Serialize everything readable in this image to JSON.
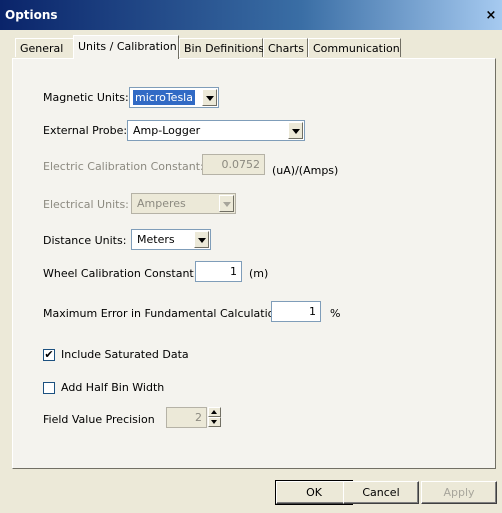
{
  "window": {
    "title": "Options",
    "close_glyph": "×"
  },
  "tabs": [
    "General",
    "Units / Calibration",
    "Bin Definitions",
    "Charts",
    "Communication"
  ],
  "active_tab": "Units / Calibration",
  "form": {
    "magnetic_units": {
      "label": "Magnetic Units:",
      "value": "microTesla"
    },
    "external_probe": {
      "label": "External Probe:",
      "value": "Amp-Logger"
    },
    "electric_calibration": {
      "label": "Electric Calibration Constant:",
      "value": "0.0752",
      "unit": "(uA)/(Amps)"
    },
    "electrical_units": {
      "label": "Electrical Units:",
      "value": "Amperes"
    },
    "distance_units": {
      "label": "Distance Units:",
      "value": "Meters"
    },
    "wheel_calibration": {
      "label": "Wheel Calibration Constant:",
      "value": "1",
      "unit": "(m)"
    },
    "max_error": {
      "label": "Maximum Error in Fundamental Calculation:",
      "value": "1",
      "unit": "%"
    },
    "include_saturated": {
      "label": "Include Saturated Data",
      "checked": true,
      "mark": "✔"
    },
    "add_half_bin": {
      "label": "Add Half Bin Width",
      "checked": false,
      "mark": ""
    },
    "field_precision": {
      "label": "Field Value Precision",
      "value": "2"
    }
  },
  "buttons": {
    "ok": "OK",
    "cancel": "Cancel",
    "apply": "Apply"
  }
}
